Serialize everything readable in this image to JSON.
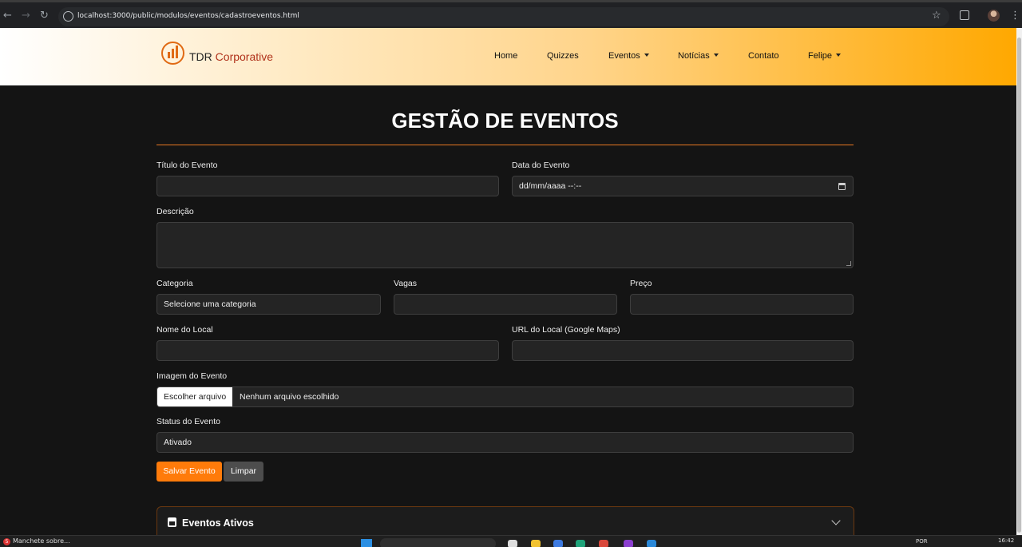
{
  "browser": {
    "url": "localhost:3000/public/modulos/eventos/cadastroeventos.html"
  },
  "header": {
    "brand_part1": "TDR",
    "brand_part2": "Corporative",
    "nav": {
      "home": "Home",
      "quizzes": "Quizzes",
      "eventos": "Eventos",
      "noticias": "Notícias",
      "contato": "Contato",
      "user": "Felipe"
    }
  },
  "form": {
    "title": "GESTÃO DE EVENTOS",
    "titulo_label": "Título do Evento",
    "data_label": "Data do Evento",
    "data_placeholder": "dd/mm/aaaa --:--",
    "descricao_label": "Descrição",
    "categoria_label": "Categoria",
    "categoria_value": "Selecione uma categoria",
    "vagas_label": "Vagas",
    "preco_label": "Preço",
    "local_label": "Nome do Local",
    "url_label": "URL do Local (Google Maps)",
    "imagem_label": "Imagem do Evento",
    "file_button": "Escolher arquivo",
    "file_status": "Nenhum arquivo escolhido",
    "status_label": "Status do Evento",
    "status_value": "Ativado",
    "save_button": "Salvar Evento",
    "clear_button": "Limpar"
  },
  "accordion": {
    "title": "Eventos Ativos"
  },
  "taskbar": {
    "app_badge": "5",
    "app_label": "Manchete sobre...",
    "language": "POR",
    "clock": "16:42"
  },
  "colors": {
    "accent": "#ff7b0a",
    "background": "#141414",
    "field_bg": "#242424"
  }
}
